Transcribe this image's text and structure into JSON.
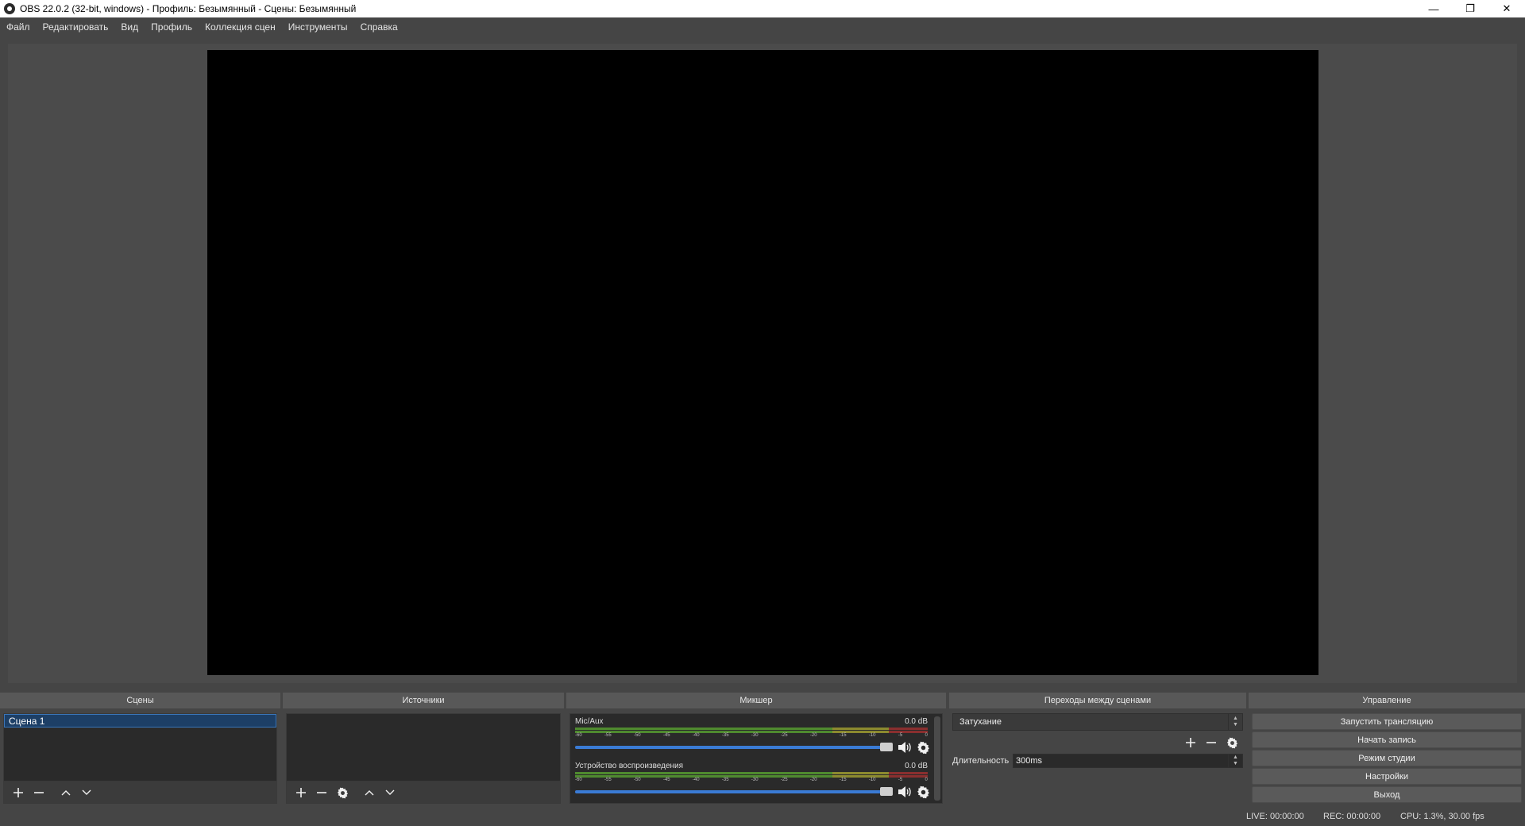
{
  "window": {
    "title": "OBS 22.0.2 (32-bit, windows) - Профиль: Безымянный - Сцены: Безымянный",
    "controls": {
      "minimize": "—",
      "restore": "❐",
      "close": "✕"
    }
  },
  "menu": [
    "Файл",
    "Редактировать",
    "Вид",
    "Профиль",
    "Коллекция сцен",
    "Инструменты",
    "Справка"
  ],
  "docks": {
    "scenes": {
      "title": "Сцены",
      "items": [
        "Сцена 1"
      ]
    },
    "sources": {
      "title": "Источники"
    },
    "mixer": {
      "title": "Микшер",
      "channels": [
        {
          "name": "Mic/Aux",
          "db": "0.0 dB"
        },
        {
          "name": "Устройство воспроизведения",
          "db": "0.0 dB"
        }
      ],
      "ticks": [
        "-60",
        "-55",
        "-50",
        "-45",
        "-40",
        "-35",
        "-30",
        "-25",
        "-20",
        "-15",
        "-10",
        "-5",
        "0"
      ]
    },
    "transitions": {
      "title": "Переходы между сценами",
      "selected": "Затухание",
      "duration_label": "Длительность",
      "duration_value": "300ms"
    },
    "controls": {
      "title": "Управление",
      "buttons": [
        "Запустить трансляцию",
        "Начать запись",
        "Режим студии",
        "Настройки",
        "Выход"
      ]
    }
  },
  "status": {
    "live": "LIVE: 00:00:00",
    "rec": "REC: 00:00:00",
    "cpu": "CPU: 1.3%, 30.00 fps"
  },
  "colors": {
    "background": "#454545",
    "preview": "#000000",
    "selection": "#1d3f66",
    "slider": "#3a7bd5"
  }
}
